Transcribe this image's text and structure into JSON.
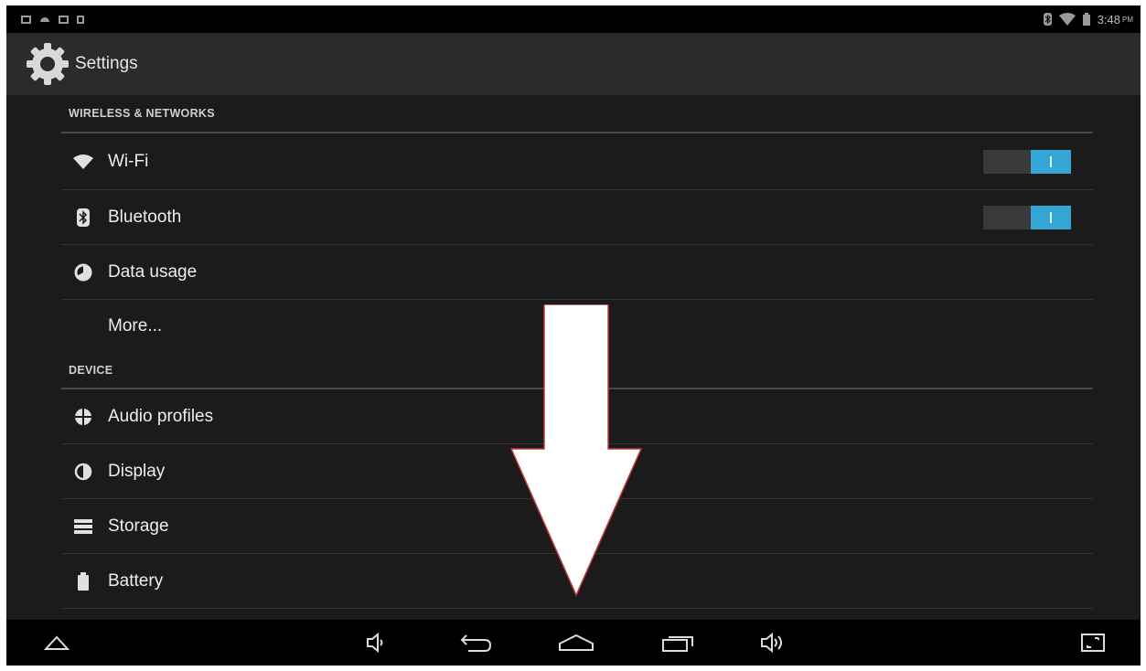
{
  "status_bar": {
    "time": "3:48",
    "ampm": "PM",
    "left_icons": [
      "notification-icon",
      "android-icon",
      "image-icon",
      "sd-card-icon"
    ],
    "right_icons": [
      "bluetooth-icon",
      "wifi-icon",
      "battery-icon"
    ]
  },
  "action_bar": {
    "title": "Settings",
    "icon": "gear-icon"
  },
  "sections": [
    {
      "header": "WIRELESS & NETWORKS",
      "items": [
        {
          "label": "Wi-Fi",
          "icon": "wifi-icon",
          "toggle": "on"
        },
        {
          "label": "Bluetooth",
          "icon": "bluetooth-icon",
          "toggle": "on"
        },
        {
          "label": "Data usage",
          "icon": "data-usage-icon"
        },
        {
          "label": "More...",
          "icon": ""
        }
      ]
    },
    {
      "header": "DEVICE",
      "items": [
        {
          "label": "Audio profiles",
          "icon": "audio-profiles-icon"
        },
        {
          "label": "Display",
          "icon": "display-icon"
        },
        {
          "label": "Storage",
          "icon": "storage-icon"
        },
        {
          "label": "Battery",
          "icon": "battery-icon"
        }
      ]
    }
  ],
  "overlay": {
    "icon": "down-arrow-icon"
  },
  "colors": {
    "accent": "#33a6d6",
    "background": "#1b1b1b",
    "action_bar": "#2b2b2b",
    "bar": "#000000"
  },
  "nav_bar": {
    "icons": [
      "up-icon",
      "volume-down-icon",
      "back-icon",
      "home-icon",
      "recents-icon",
      "volume-up-icon",
      "screenshot-icon"
    ]
  }
}
